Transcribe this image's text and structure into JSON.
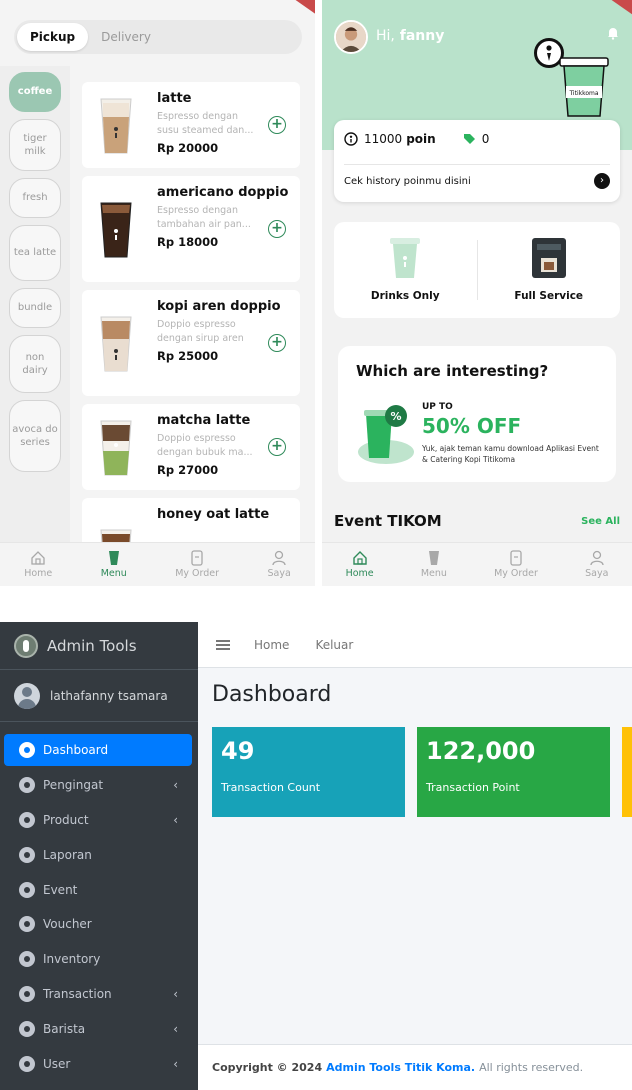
{
  "menu_app": {
    "order_modes": [
      "Pickup",
      "Delivery"
    ],
    "categories": [
      "coffee",
      "tiger milk",
      "fresh",
      "tea latte",
      "bundle",
      "non dairy",
      "avoca do series"
    ],
    "products": [
      {
        "name": "latte",
        "desc": "Espresso dengan susu steamed dan...",
        "price": "Rp 20000"
      },
      {
        "name": "americano doppio",
        "desc": "Espresso dengan tambahan air pan...",
        "price": "Rp 18000"
      },
      {
        "name": "kopi aren doppio",
        "desc": "Doppio espresso dengan sirup aren",
        "price": "Rp 25000"
      },
      {
        "name": "matcha latte",
        "desc": "Doppio espresso dengan bubuk ma...",
        "price": "Rp 27000"
      },
      {
        "name": "honey oat latte",
        "desc": "",
        "price": ""
      }
    ],
    "tabs": [
      "Home",
      "Menu",
      "My Order",
      "Saya"
    ]
  },
  "home_app": {
    "greeting_prefix": "Hi,",
    "user": "fanny",
    "cup_brand": "Titikkoma",
    "points_value": "11000",
    "points_label": "poin",
    "voucher_count": "0",
    "history_link": "Cek history poinmu disini",
    "services": [
      "Drinks Only",
      "Full Service"
    ],
    "promo": {
      "title": "Which are interesting?",
      "upto": "UP TO",
      "discount": "50% OFF",
      "desc": "Yuk, ajak teman kamu download Aplikasi Event & Catering Kopi Titikoma"
    },
    "event_title": "Event TIKOM",
    "see_all": "See All",
    "tabs": [
      "Home",
      "Menu",
      "My Order",
      "Saya"
    ]
  },
  "admin": {
    "brand": "Admin Tools",
    "username": "lathafanny tsamara",
    "nav": [
      {
        "label": "Dashboard",
        "active": true,
        "chevron": false
      },
      {
        "label": "Pengingat",
        "chevron": true
      },
      {
        "label": "Product",
        "chevron": true
      },
      {
        "label": "Laporan",
        "chevron": false
      },
      {
        "label": "Event",
        "chevron": false
      },
      {
        "label": "Voucher",
        "chevron": false
      },
      {
        "label": "Inventory",
        "chevron": false
      },
      {
        "label": "Transaction",
        "chevron": true
      },
      {
        "label": "Barista",
        "chevron": true
      },
      {
        "label": "User",
        "chevron": true
      }
    ],
    "topnav": [
      "Home",
      "Keluar"
    ],
    "page_title": "Dashboard",
    "stats": [
      {
        "value": "49",
        "label": "Transaction Count",
        "color": "#17a2b8"
      },
      {
        "value": "122,000",
        "label": "Transaction Point",
        "color": "#28a745"
      },
      {
        "value": "",
        "label": "",
        "color": "#ffc107"
      }
    ],
    "footer": {
      "prefix": "Copyright © 2024",
      "brand": "Admin Tools Titik Koma.",
      "suffix": "All rights reserved."
    },
    "chevron_glyph": "‹"
  },
  "colors": {
    "accent_green": "#2f8a5a",
    "mint": "#b9e2cb",
    "admin_blue": "#007bff",
    "sidebar": "#343a40"
  }
}
